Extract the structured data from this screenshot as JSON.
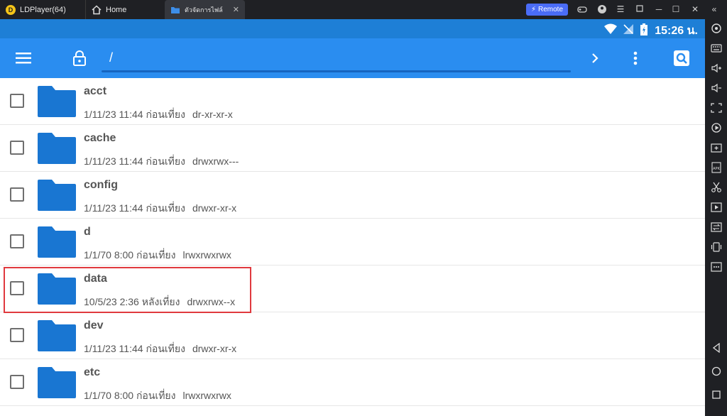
{
  "titlebar": {
    "app_name": "LDPlayer(64)",
    "tabs": [
      {
        "label": "Home"
      },
      {
        "label": "ตัวจัดการไฟล์"
      }
    ],
    "remote_label": "Remote"
  },
  "statusbar": {
    "time": "15:26 น."
  },
  "appbar": {
    "path": "/"
  },
  "files": [
    {
      "name": "acct",
      "date": "1/11/23 11:44 ก่อนเที่ยง",
      "perm": "dr-xr-xr-x"
    },
    {
      "name": "cache",
      "date": "1/11/23 11:44 ก่อนเที่ยง",
      "perm": "drwxrwx---"
    },
    {
      "name": "config",
      "date": "1/11/23 11:44 ก่อนเที่ยง",
      "perm": "drwxr-xr-x"
    },
    {
      "name": "d",
      "date": "1/1/70 8:00 ก่อนเที่ยง",
      "perm": "lrwxrwxrwx"
    },
    {
      "name": "data",
      "date": "10/5/23 2:36 หลังเที่ยง",
      "perm": "drwxrwx--x"
    },
    {
      "name": "dev",
      "date": "1/11/23 11:44 ก่อนเที่ยง",
      "perm": "drwxr-xr-x"
    },
    {
      "name": "etc",
      "date": "1/1/70 8:00 ก่อนเที่ยง",
      "perm": "lrwxrwxrwx"
    }
  ],
  "colors": {
    "accent": "#2a8df0",
    "statusbar": "#1e7fd6",
    "folder": "#1976d2",
    "highlight": "#e0393e"
  }
}
